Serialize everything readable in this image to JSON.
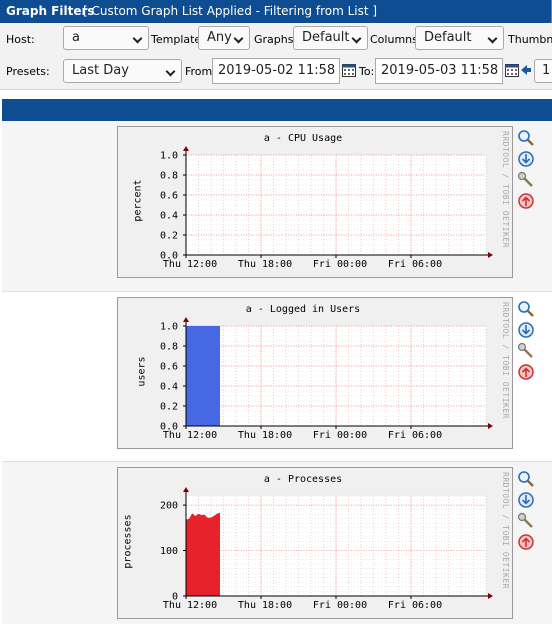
{
  "header": {
    "title": "Graph Filters",
    "subtitle": "[ Custom Graph List Applied - Filtering from List ]"
  },
  "filters": {
    "host_label": "Host:",
    "host_value": "a",
    "template_label": "Template:",
    "template_value": "Any",
    "graphs_label": "Graphs:",
    "graphs_value": "Default",
    "columns_label": "Columns:",
    "columns_value": "Default",
    "thumbnails_label": "Thumbnails",
    "presets_label": "Presets:",
    "presets_value": "Last Day",
    "from_label": "From:",
    "from_value": "2019-05-02 11:58",
    "to_label": "To:",
    "to_value": "2019-05-03 11:58",
    "timespan_value": "1"
  },
  "x_ticks": [
    "Thu 12:00",
    "Thu 18:00",
    "Fri 00:00",
    "Fri 06:00"
  ],
  "watermark": "RRDTOOL / TOBI OETIKER",
  "graphs": [
    {
      "title": "a - CPU Usage",
      "ylabel": "percent",
      "y_ticks": [
        "1.0",
        "0.8",
        "0.6",
        "0.4",
        "0.2",
        "0.0"
      ],
      "icons": [
        "zoom-icon",
        "download-icon",
        "edit-icon",
        "up-icon"
      ]
    },
    {
      "title": "a - Logged in Users",
      "ylabel": "users",
      "y_ticks": [
        "1.0",
        "0.8",
        "0.6",
        "0.4",
        "0.2",
        "0.0"
      ],
      "icons": [
        "zoom-icon",
        "download-icon",
        "edit-icon",
        "up-icon"
      ]
    },
    {
      "title": "a - Processes",
      "ylabel": "processes",
      "y_ticks": [
        "200",
        "100",
        "0"
      ],
      "icons": [
        "zoom-icon",
        "download-icon",
        "edit-icon",
        "up-icon"
      ]
    }
  ],
  "chart_data": [
    {
      "type": "area",
      "title": "a - CPU Usage",
      "ylabel": "percent",
      "ylim": [
        0,
        1.0
      ],
      "x_ticks": [
        "Thu 12:00",
        "Thu 18:00",
        "Fri 00:00",
        "Fri 06:00"
      ],
      "series": [
        {
          "values": [
            0,
            0,
            0,
            0
          ]
        }
      ],
      "color": "#000000"
    },
    {
      "type": "area",
      "title": "a - Logged in Users",
      "ylabel": "users",
      "ylim": [
        0,
        1.0
      ],
      "x_ticks": [
        "Thu 12:00",
        "Thu 18:00",
        "Fri 00:00",
        "Fri 06:00"
      ],
      "series": [
        {
          "values": [
            1,
            1,
            1,
            1,
            1,
            1
          ]
        }
      ],
      "color": "#4668e4"
    },
    {
      "type": "area",
      "title": "a - Processes",
      "ylabel": "processes",
      "ylim": [
        0,
        220
      ],
      "x_ticks": [
        "Thu 12:00",
        "Thu 18:00",
        "Fri 00:00",
        "Fri 06:00"
      ],
      "series": [
        {
          "values": [
            168,
            170,
            182,
            176,
            181,
            178,
            179,
            172,
            172,
            176,
            181,
            183
          ]
        }
      ],
      "color": "#e8222a"
    }
  ]
}
